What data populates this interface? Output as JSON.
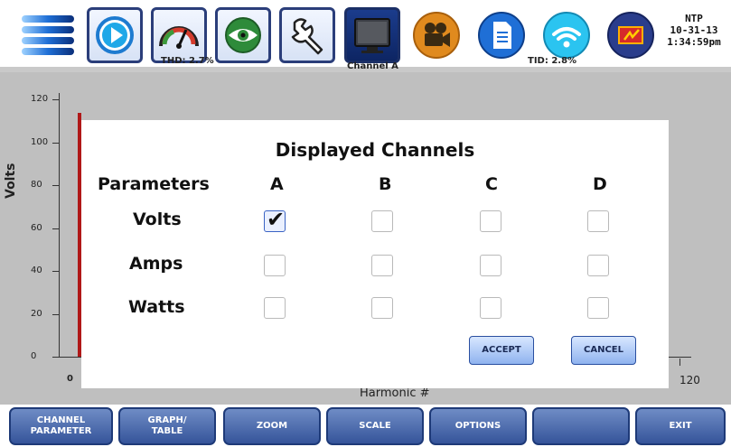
{
  "toolbar": {
    "icons": [
      "menu-lines-icon",
      "play-icon",
      "gauge-icon",
      "eye-icon",
      "wrench-icon",
      "monitor-icon",
      "camera-icon",
      "document-icon",
      "wifi-icon",
      "power-icon"
    ]
  },
  "status": {
    "ntp": "NTP",
    "date": "10-31-13",
    "time": "1:34:59pm"
  },
  "graph": {
    "channel_title": "Channel A",
    "thd": "THD: 2.7%",
    "tid": "TID: 2.8%",
    "ylabel": "Volts",
    "yticks": [
      "120",
      "100",
      "80",
      "60",
      "40",
      "20",
      "0"
    ],
    "xlabel": "Harmonic #",
    "x_min_label": "0",
    "x_max_label": "120"
  },
  "dialog": {
    "title": "Displayed Channels",
    "param_header": "Parameters",
    "columns": [
      "A",
      "B",
      "C",
      "D"
    ],
    "rows": [
      {
        "label": "Volts",
        "checks": [
          true,
          false,
          false,
          false
        ]
      },
      {
        "label": "Amps",
        "checks": [
          false,
          false,
          false,
          false
        ]
      },
      {
        "label": "Watts",
        "checks": [
          false,
          false,
          false,
          false
        ]
      }
    ],
    "checkmark": "✔",
    "accept_label": "ACCEPT",
    "cancel_label": "CANCEL"
  },
  "bottom": {
    "buttons": [
      "CHANNEL\nPARAMETER",
      "GRAPH/\nTABLE",
      "ZOOM",
      "SCALE",
      "OPTIONS",
      "",
      "EXIT"
    ]
  },
  "colors": {
    "button_blue": "#35549a",
    "graph_bg": "#bfbfbf",
    "trace_red": "#b01818"
  }
}
